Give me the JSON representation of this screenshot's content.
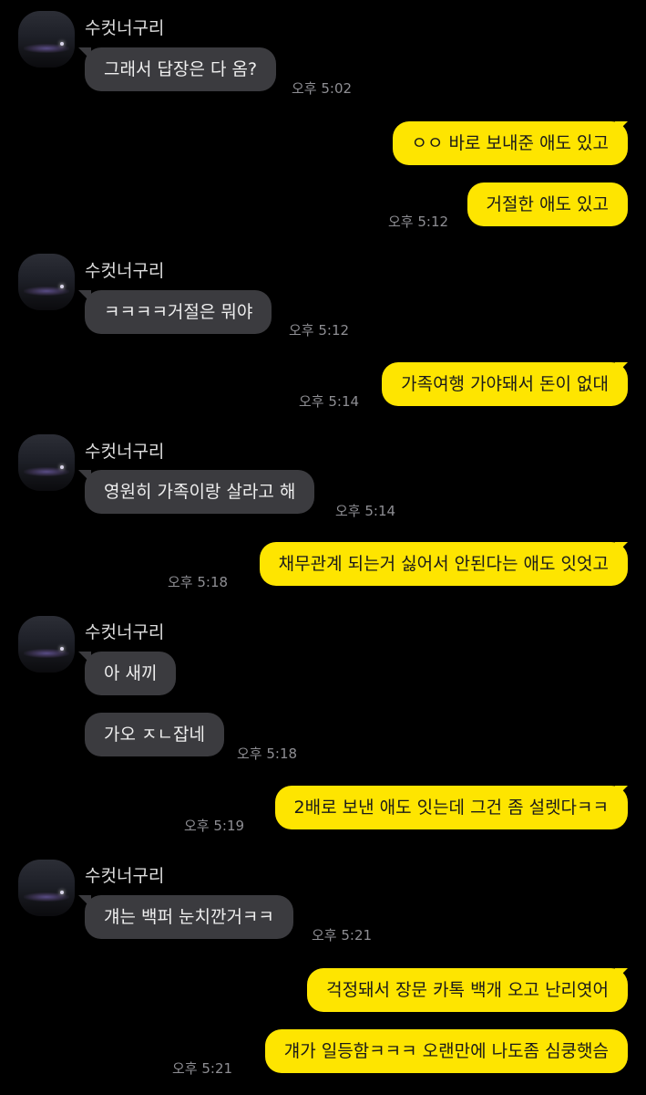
{
  "sender_name": "수컷너구리",
  "messages": [
    {
      "from": "in",
      "text": "그래서 답장은 다 옴?",
      "time": "오후 5:02"
    },
    {
      "from": "out",
      "text": "ㅇㅇ 바로 보내준 애도 있고",
      "time": ""
    },
    {
      "from": "out",
      "text": "거절한 애도 있고",
      "time": "오후 5:12"
    },
    {
      "from": "in",
      "text": "ㅋㅋㅋㅋ거절은 뭐야",
      "time": "오후 5:12"
    },
    {
      "from": "out",
      "text": "가족여행 가야돼서 돈이 없대",
      "time": "오후 5:14"
    },
    {
      "from": "in",
      "text": "영원히 가족이랑 살라고 해",
      "time": "오후 5:14"
    },
    {
      "from": "out",
      "text": "채무관계 되는거 싫어서 안된다는 애도 잇엇고",
      "time": "오후 5:18"
    },
    {
      "from": "in",
      "text": "아 새끼",
      "time": ""
    },
    {
      "from": "in",
      "text": "가오 ㅈㄴ잡네",
      "time": "오후 5:18"
    },
    {
      "from": "out",
      "text": "2배로 보낸 애도 잇는데 그건 좀 설렛다ㅋㅋ",
      "time": "오후 5:19"
    },
    {
      "from": "in",
      "text": "걔는 백퍼 눈치깐거ㅋㅋ",
      "time": "오후 5:21"
    },
    {
      "from": "out",
      "text": "걱정돼서 장문 카톡 백개 오고 난리엿어",
      "time": ""
    },
    {
      "from": "out",
      "text": "걔가 일등함ㅋㅋㅋ 오랜만에 나도좀 심쿵햇슴",
      "time": "오후 5:21"
    }
  ]
}
